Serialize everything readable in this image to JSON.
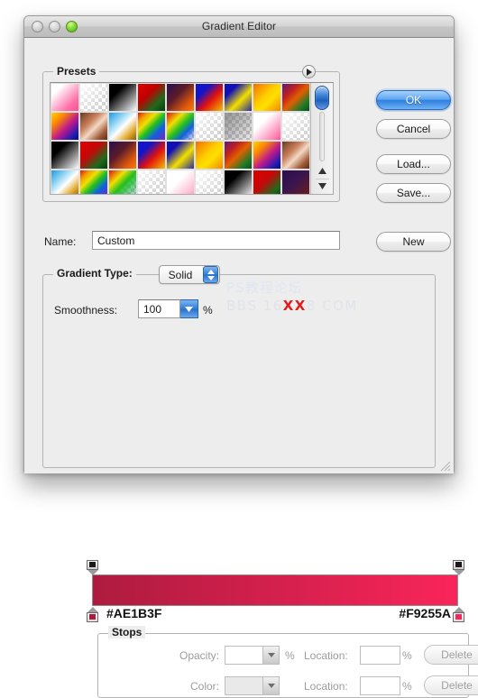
{
  "window": {
    "title": "Gradient Editor",
    "traffic_lights": [
      "close-button",
      "minimize-button",
      "zoom-button"
    ]
  },
  "presets": {
    "label": "Presets",
    "disclosure_icon": "disclosure-triangle-icon",
    "scroll_up_icon": "triangle-up-icon",
    "scroll_down_icon": "triangle-down-icon",
    "swatches": [
      {
        "name": "pink-white",
        "css": "linear-gradient(135deg,#ffffff 0%,#ffffff 22%,#ff6fa8 75%,#ff4f93 100%)"
      },
      {
        "name": "white-transparent",
        "checker": true,
        "css": "linear-gradient(135deg,#ffffff 0%,rgba(255,255,255,0) 100%)"
      },
      {
        "name": "black-white",
        "css": "linear-gradient(135deg,#000000 0%,#000000 30%,#ffffff 100%)"
      },
      {
        "name": "red-green",
        "css": "linear-gradient(135deg,#e00000 0%,#c00000 38%,#1d6b1d 72%,#0a3a0a 100%)"
      },
      {
        "name": "purple-orange",
        "css": "linear-gradient(135deg,#2a0f4d 0%,#5b1b2a 40%,#e35a0a 78%,#f08000 100%)"
      },
      {
        "name": "blue-red-yellow",
        "css": "linear-gradient(135deg,#1414c8 0%,#1414c8 28%,#e01010 58%,#f0c000 100%)"
      },
      {
        "name": "blue-yellow",
        "css": "linear-gradient(135deg,#1010b4 0%,#1010b4 25%,#f2e000 60%,#2a2a9e 100%)"
      },
      {
        "name": "orange-yellow",
        "css": "linear-gradient(135deg,#f07000 0%,#ffd000 45%,#ffe000 62%,#f08800 100%)"
      },
      {
        "name": "purple-green-rainbow",
        "css": "linear-gradient(135deg,#5a1a7a 0%,#c02020 30%,#e06000 52%,#1a7a2a 80%,#0d4d18 100%)"
      },
      {
        "name": "yellow-magenta-blue",
        "css": "linear-gradient(135deg,#ffd400 0%,#ff8c00 25%,#c01a8a 55%,#1a1ab4 85%,#0a0a6a 100%)"
      },
      {
        "name": "copper",
        "css": "linear-gradient(135deg,#6a3a22 0%,#c8805a 35%,#f4d8c4 55%,#a05a36 80%,#5a2e18 100%)"
      },
      {
        "name": "blue-white-gold",
        "css": "linear-gradient(135deg,#1a9ae0 0%,#bfe8fa 40%,#ffffff 52%,#e0a828 78%,#8a5c10 100%)"
      },
      {
        "name": "spectrum",
        "css": "linear-gradient(135deg,#e01010 0%,#f0a000 18%,#f0e000 34%,#20c020 52%,#1060e0 72%,#8020c0 100%)"
      },
      {
        "name": "spectrum-transparent",
        "checker": true,
        "css": "linear-gradient(135deg,#e01010 0%,#f0e000 30%,#20c020 52%,#1060e0 72%,rgba(192,32,192,0.1) 100%)"
      },
      {
        "name": "white-transparent-2",
        "checker": true,
        "css": "linear-gradient(135deg,rgba(255,255,255,0.95) 0%,rgba(255,255,255,0) 100%)"
      },
      {
        "name": "gray-transparent",
        "checker": true,
        "css": "linear-gradient(135deg,rgba(128,128,128,0.85) 0%,rgba(128,128,128,0.15) 100%)"
      },
      {
        "name": "white-pink",
        "css": "linear-gradient(135deg,#ffffff 0%,#ffffff 35%,#ff7fb0 85%,#ff4f92 100%)"
      },
      {
        "name": "white-transparent-3",
        "checker": true,
        "css": "linear-gradient(135deg,#ffffff 0%,rgba(255,255,255,0.05) 100%)"
      },
      {
        "name": "black-white-2",
        "css": "linear-gradient(135deg,#000000 0%,#000000 30%,#ffffff 100%)"
      },
      {
        "name": "red-green-2",
        "css": "linear-gradient(135deg,#e00000 0%,#c40808 40%,#1d6b1d 75%,#0a3a0a 100%)"
      },
      {
        "name": "purple-orange-2",
        "css": "linear-gradient(135deg,#2a0f4d 0%,#5b1b2a 40%,#e35a0a 78%,#f08000 100%)"
      },
      {
        "name": "blue-red-yellow-2",
        "css": "linear-gradient(135deg,#1414c8 0%,#1414c8 28%,#e01010 58%,#f0c000 100%)"
      },
      {
        "name": "blue-yellow-2",
        "css": "linear-gradient(135deg,#1010b4 0%,#1010b4 25%,#f2e000 60%,#2a2a9e 100%)"
      },
      {
        "name": "orange-yellow-2",
        "css": "linear-gradient(135deg,#f07000 0%,#ffd000 45%,#ffe000 62%,#f08800 100%)"
      },
      {
        "name": "purple-green",
        "css": "linear-gradient(135deg,#5a1a7a 0%,#c02020 28%,#e06000 50%,#1a7a2a 80%,#0d4d18 100%)"
      },
      {
        "name": "yellow-magenta-blue-2",
        "css": "linear-gradient(135deg,#ffd400 0%,#ff8c00 25%,#c01a8a 55%,#1a1ab4 85%,#0a0a6a 100%)"
      },
      {
        "name": "copper-2",
        "css": "linear-gradient(135deg,#6a3a22 0%,#c8805a 35%,#f4d8c4 55%,#a05a36 80%,#5a2e18 100%)"
      },
      {
        "name": "blue-white-gold-2",
        "css": "linear-gradient(135deg,#1a9ae0 0%,#bfe8fa 40%,#ffffff 52%,#e0a828 78%,#8a5c10 100%)"
      },
      {
        "name": "spectrum-2",
        "css": "linear-gradient(135deg,#e01010 0%,#f0a000 18%,#f0e000 34%,#20c020 52%,#1060e0 72%,#8020c0 100%)"
      },
      {
        "name": "spectrum-transparent-2",
        "checker": true,
        "css": "linear-gradient(135deg,#e01010 0%,#f0e000 30%,#20c020 52%,rgba(16,96,224,0.2) 100%)"
      },
      {
        "name": "white-transparent-4",
        "checker": true,
        "css": "linear-gradient(135deg,rgba(255,255,255,0.9) 0%,rgba(255,255,255,0) 100%)"
      },
      {
        "name": "white-pink-2",
        "css": "linear-gradient(135deg,#ffffff 0%,#ffffff 40%,#ffb8d0 85%,#ff8fb4 100%)"
      },
      {
        "name": "white-transparent-5",
        "checker": true,
        "css": "linear-gradient(135deg,#ffffff 0%,rgba(255,255,255,0.08) 100%)"
      },
      {
        "name": "black-white-3",
        "css": "linear-gradient(135deg,#000000 0%,#000000 32%,#ffffff 100%)"
      },
      {
        "name": "red-green-3",
        "css": "linear-gradient(135deg,#e00000 0%,#c40808 42%,#1d6b1d 78%,#0a3a0a 100%)"
      },
      {
        "name": "purple-dark",
        "css": "linear-gradient(135deg,#2a0f4d 0%,#3a1550 45%,#5b1b2a 80%,#6a2010 100%)"
      }
    ]
  },
  "buttons": {
    "ok": "OK",
    "cancel": "Cancel",
    "load": "Load...",
    "save": "Save...",
    "new": "New"
  },
  "name_row": {
    "label": "Name:",
    "value": "Custom"
  },
  "gradient_type": {
    "label": "Gradient Type:",
    "value": "Solid",
    "stepper_icon": "stepper-up-down-icon"
  },
  "smoothness": {
    "label": "Smoothness:",
    "value": "100",
    "percent": "%",
    "arrow_icon": "chevron-down-icon"
  },
  "watermark": {
    "line1": "PS教程论坛",
    "line2_pre": "BBS 16",
    "line2_hl": "XX",
    "line2_post": "8 COM"
  },
  "gradient": {
    "start_hex": "#AE1B3F",
    "end_hex": "#F9255A",
    "bar_css": "linear-gradient(to right,#AE1B3F 0%,#F9255A 100%)",
    "opacity_stop_icon": "opacity-stop-marker",
    "color_stop_icon": "color-stop-marker"
  },
  "stops": {
    "label": "Stops",
    "opacity_label": "Opacity:",
    "color_label": "Color:",
    "location_label": "Location:",
    "percent": "%",
    "opacity_value": "",
    "color_value": "",
    "location1_value": "",
    "location2_value": "",
    "delete_label": "Delete",
    "dropdown_icon": "chevron-down-icon"
  },
  "resize_grip_icon": "resize-grip-icon"
}
